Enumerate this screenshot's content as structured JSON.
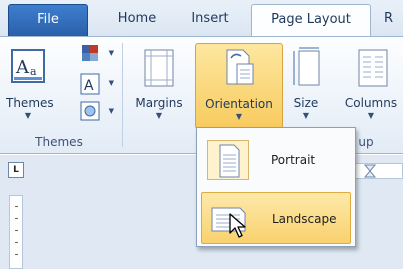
{
  "tabs": {
    "file": "File",
    "home": "Home",
    "insert": "Insert",
    "page_layout": "Page Layout",
    "review_partial": "R"
  },
  "ribbon": {
    "themes_group": {
      "themes_label": "Themes",
      "group_label": "Themes"
    },
    "page_setup_group": {
      "margins_label": "Margins",
      "orientation_label": "Orientation",
      "size_label": "Size",
      "columns_label": "Columns",
      "group_label_partial": "up"
    }
  },
  "orientation_menu": {
    "portrait_label": "Portrait",
    "landscape_label": "Landscape",
    "selected": "Landscape"
  },
  "ruler": {
    "tab_selector": "L"
  },
  "colors": {
    "file_tab": "#2a5fa8",
    "highlight": "#f8cb5f",
    "ribbon_bg": "#e2ebf6"
  }
}
